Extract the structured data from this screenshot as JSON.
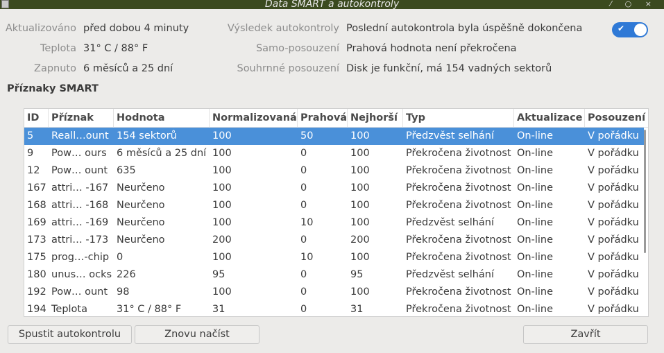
{
  "window": {
    "title": "Data SMART a autokontroly",
    "controls": [
      "⁄",
      "○",
      "×"
    ]
  },
  "info_left": [
    {
      "label": "Aktualizováno",
      "value": "před dobou 4 minuty"
    },
    {
      "label": "Teplota",
      "value": "31° C / 88° F"
    },
    {
      "label": "Zapnuto",
      "value": "6 měsíců a 25 dní"
    }
  ],
  "info_right": [
    {
      "label": "Výsledek autokontroly",
      "value": "Poslední autokontrola byla úspěšně dokončena"
    },
    {
      "label": "Samo-posouzení",
      "value": "Prahová hodnota není překročena"
    },
    {
      "label": "Souhrnné posouzení",
      "value": "Disk je funkční, má 154 vadných sektorů"
    }
  ],
  "toggle": {
    "icon": "check-icon",
    "state": "on",
    "glyph": "✔"
  },
  "section_title": "Příznaky SMART",
  "table": {
    "headers": [
      "ID",
      "Příznak",
      "Hodnota",
      "Normalizovaná",
      "Prahová",
      "Nejhorší",
      "Typ",
      "Aktualizace",
      "Posouzení"
    ],
    "rows": [
      [
        "5",
        "Reall…ount",
        "154 sektorů",
        "100",
        "50",
        "100",
        "Předzvěst selhání",
        "On-line",
        "V pořádku"
      ],
      [
        "9",
        "Pow… ours",
        "6 měsíců a 25 dní",
        "100",
        "0",
        "100",
        "Překročena životnost",
        "On-line",
        "V pořádku"
      ],
      [
        "12",
        "Pow… ount",
        "635",
        "100",
        "0",
        "100",
        "Překročena životnost",
        "On-line",
        "V pořádku"
      ],
      [
        "167",
        "attri… -167",
        "Neurčeno",
        "100",
        "0",
        "100",
        "Překročena životnost",
        "On-line",
        "V pořádku"
      ],
      [
        "168",
        "attri… -168",
        "Neurčeno",
        "100",
        "0",
        "100",
        "Překročena životnost",
        "On-line",
        "V pořádku"
      ],
      [
        "169",
        "attri… -169",
        "Neurčeno",
        "100",
        "10",
        "100",
        "Předzvěst selhání",
        "On-line",
        "V pořádku"
      ],
      [
        "173",
        "attri… -173",
        "Neurčeno",
        "200",
        "0",
        "200",
        "Překročena životnost",
        "On-line",
        "V pořádku"
      ],
      [
        "175",
        "prog…-chip",
        "0",
        "100",
        "10",
        "100",
        "Překročena životnost",
        "On-line",
        "V pořádku"
      ],
      [
        "180",
        "unus… ocks",
        "226",
        "95",
        "0",
        "95",
        "Předzvěst selhání",
        "On-line",
        "V pořádku"
      ],
      [
        "192",
        "Pow… ount",
        "98",
        "100",
        "0",
        "100",
        "Překročena životnost",
        "On-line",
        "V pořádku"
      ],
      [
        "194",
        "Teplota",
        "31° C / 88° F",
        "31",
        "0",
        "31",
        "Překročena životnost",
        "On-line",
        "V pořádku"
      ]
    ],
    "selected_row": 0
  },
  "buttons": {
    "run_selftest": "Spustit autokontrolu",
    "reload": "Znovu načíst",
    "close": "Zavřít"
  }
}
